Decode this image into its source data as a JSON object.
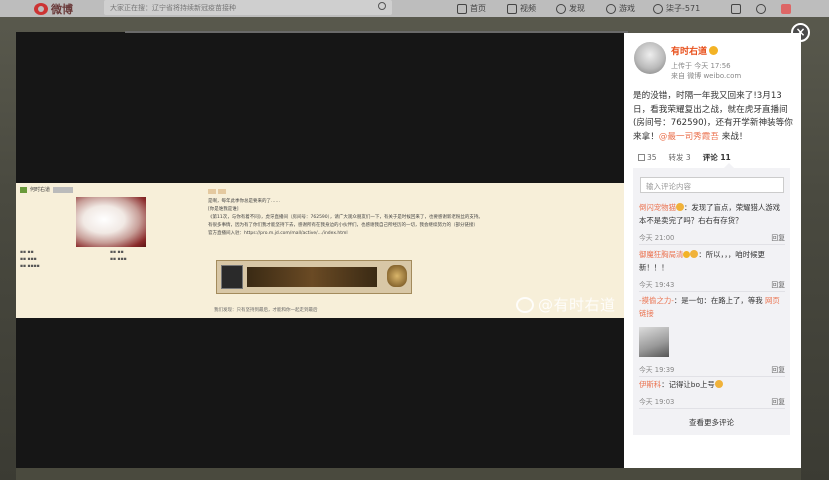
{
  "header": {
    "logo_text": "微博",
    "search_text": "大家正在搜：辽宁省将持续新冠疫苗接种",
    "nav": [
      {
        "label": "首页",
        "icon": "home-icon"
      },
      {
        "label": "视频",
        "icon": "video-icon"
      },
      {
        "label": "发现",
        "icon": "discover-icon"
      },
      {
        "label": "游戏",
        "icon": "game-icon"
      },
      {
        "label": "柒子-571",
        "icon": "user-icon"
      }
    ]
  },
  "photo": {
    "username": "何时右道",
    "watermark": "@有时右道",
    "post_lines": [
      "是啊，每年此季你总是要来的了……",
      "[你是谁我是谁]",
      "《第11次，与你有着不同》，虎牙直播间（房间号：762590），请广大观众朋友们一下，有关于是时候回来了，也要感谢新老粉丝的支持。",
      "有很多事情，因为有了你们我才能坚持下去，感谢所有在我身边的小伙伴们，也感谢我自己所经历的一切，我会继续努力的（部分链接）",
      "官方直播间入驻：https://pro.m.jd.com/mall/active/…/index.html"
    ],
    "panel_label": "隐藏",
    "footer_text": "我们发现：只有坚持到最后，才能和你一起走到最后"
  },
  "sidebar": {
    "author": "有时右道",
    "time": "上传于 今天 17:56",
    "source": "来自 微博 weibo.com",
    "text": "是的没错，时隔一年我又回来了!3月13日，看我荣耀复出之战，就在虎牙直播间(房间号：762590)，还有开学新神装等你来拿！",
    "mention": "@最一司秀霞吾",
    "text_tail": " 来战！",
    "likes": "35",
    "reposts_label": "转发 3",
    "comments_label": "评论 11",
    "comment_placeholder": "输入评论内容",
    "comments": [
      {
        "user": "倒闪宠物猫",
        "text": "：发现了盲点，荣耀猎人游戏本不是卖完了吗？右右有存货？",
        "time": "今天 21:00",
        "reply": "回复"
      },
      {
        "user": "御魔狂胸局清",
        "text": "：所以，，，咱时候更新！！！",
        "time": "今天 19:43",
        "reply": "回复"
      },
      {
        "user": "-摸偷之力-",
        "text": "：是一句：在路上了，等我",
        "link": "网页链接",
        "time": "今天 19:39",
        "reply": "回复"
      },
      {
        "user": "伊斯科",
        "text": "：记得让bo上号",
        "time": "今天 19:03",
        "reply": "回复"
      }
    ],
    "more": "查看更多评论"
  },
  "colors": {
    "accent": "#eb7350",
    "name": "#e8501c",
    "verified": "#f3b326"
  }
}
